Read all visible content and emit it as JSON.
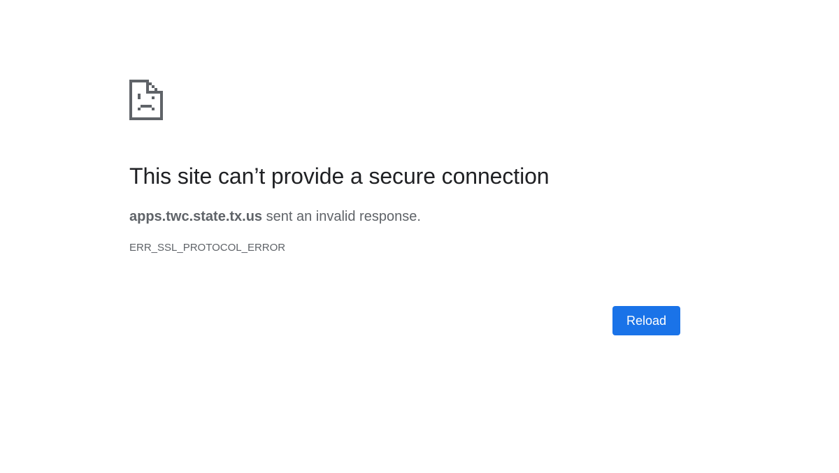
{
  "error_page": {
    "icon": "sad-page-icon",
    "title": "This site can’t provide a secure connection",
    "summary": {
      "host": "apps.twc.state.tx.us",
      "message": " sent an invalid response."
    },
    "error_code": "ERR_SSL_PROTOCOL_ERROR",
    "reload_label": "Reload"
  },
  "colors": {
    "background": "#ffffff",
    "title": "#202124",
    "secondary_text": "#5f6368",
    "icon": "#5f6368",
    "button": "#1a73e8",
    "button_text": "#ffffff"
  }
}
